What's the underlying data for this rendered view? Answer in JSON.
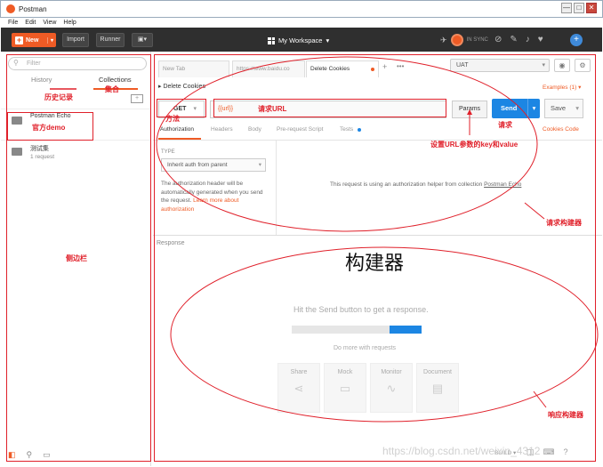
{
  "window": {
    "title": "Postman",
    "controls": [
      "—",
      "□",
      "✕"
    ]
  },
  "menu": [
    "File",
    "Edit",
    "View",
    "Help"
  ],
  "toolbar": {
    "new_label": "New",
    "import_label": "Import",
    "runner_label": "Runner",
    "workspace_label": "My Workspace",
    "sync_label": "IN SYNC"
  },
  "sidebar": {
    "filter_placeholder": "Filter",
    "tabs": [
      "History",
      "Collections"
    ],
    "collections": [
      {
        "name": "Postman Echo",
        "count": ""
      },
      {
        "name": "测试集",
        "count": "1 request"
      }
    ]
  },
  "tabs": [
    {
      "label": "New Tab"
    },
    {
      "label": "https://www.baidu.co"
    },
    {
      "label": "Delete Cookies"
    }
  ],
  "env": {
    "selected": "UAT"
  },
  "request": {
    "name": "Delete Cookies",
    "examples": "Examples (1) ▾",
    "method": "GET",
    "url": "{{url}}",
    "params_label": "Params",
    "send_label": "Send",
    "save_label": "Save",
    "subtabs": [
      "Authorization",
      "Headers",
      "Body",
      "Pre-request Script",
      "Tests"
    ],
    "cookies_code": "Cookies   Code",
    "type_label": "TYPE",
    "type_value": "Inherit auth from parent",
    "auth_help": "The authorization header will be automatically generated when you send the request. ",
    "auth_help_link": "Learn more about authorization",
    "auth_msg": "This request is using an authorization helper from collection ",
    "auth_msg_link": "Postman Echo"
  },
  "response": {
    "title": "Response",
    "hit_send": "Hit the Send button to get a response.",
    "do_more": "Do more with requests",
    "cards": [
      "Share",
      "Mock",
      "Monitor",
      "Document"
    ]
  },
  "status_bar": {
    "build": "BUILD ▾"
  },
  "annotations": {
    "history": "历史记录",
    "collections": "集合",
    "demo": "官方demo",
    "sidebar": "侧边栏",
    "method": "方法",
    "url": "请求URL",
    "request": "请求",
    "params": "设置URL参数的key和value",
    "builder": "请求构建器",
    "big": "构建器",
    "response_builder": "响应构建器"
  },
  "watermark": "https://blog.csdn.net/weixin_4312"
}
